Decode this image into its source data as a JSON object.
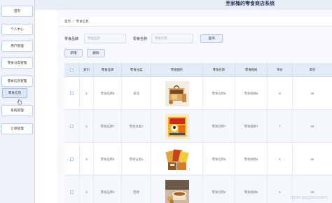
{
  "app": {
    "title": "至家桶的零食商店系统"
  },
  "sidebar": {
    "items": [
      {
        "label": "首页"
      },
      {
        "label": "个人中心"
      },
      {
        "label": "用户管理"
      },
      {
        "label": "零食分类管理"
      },
      {
        "label": "零食信息管理"
      },
      {
        "label": "零食信息"
      },
      {
        "label": "系统管理"
      },
      {
        "label": "订单管理"
      }
    ]
  },
  "breadcrumb": {
    "home": "首页",
    "current": "零食信息"
  },
  "filters": {
    "brand_label": "零食品牌",
    "brand_placeholder": "零食品牌",
    "name_label": "零食名称",
    "name_placeholder": "零食名称",
    "search_button": "查询"
  },
  "actions": {
    "add": "新增",
    "delete": "删除"
  },
  "table": {
    "columns": [
      "索引",
      "零食品牌",
      "零食分类",
      "零食图片",
      "零食名称",
      "零食规格",
      "单价",
      "库存"
    ],
    "rows": [
      {
        "index": "1",
        "brand": "零食品牌8",
        "category": "食品",
        "image": "snack-box-image",
        "name": "零食名称8",
        "spec": "零食规格8",
        "price": "8",
        "stock": "56"
      },
      {
        "index": "2",
        "brand": "零食品牌7",
        "category": "零食分类7",
        "image": "chips-package-image",
        "name": "零食名称7",
        "spec": "零食规格7",
        "price": "7",
        "stock": "56"
      },
      {
        "index": "3",
        "brand": "零食品牌6",
        "category": "零食分类6",
        "image": "snack-bags-image",
        "name": "零食名称6",
        "spec": "零食规格6",
        "price": "6",
        "stock": "56"
      },
      {
        "index": "4",
        "brand": "零食品牌5",
        "category": "西饼",
        "image": "tea-snack-image",
        "name": "零食名称5",
        "spec": "零食规格5",
        "price": "5",
        "stock": "56"
      }
    ]
  },
  "watermark": "CSDN @QQ242219979",
  "colors": {
    "accent": "#e3ebf7",
    "sidebar": "#eef3fb"
  }
}
